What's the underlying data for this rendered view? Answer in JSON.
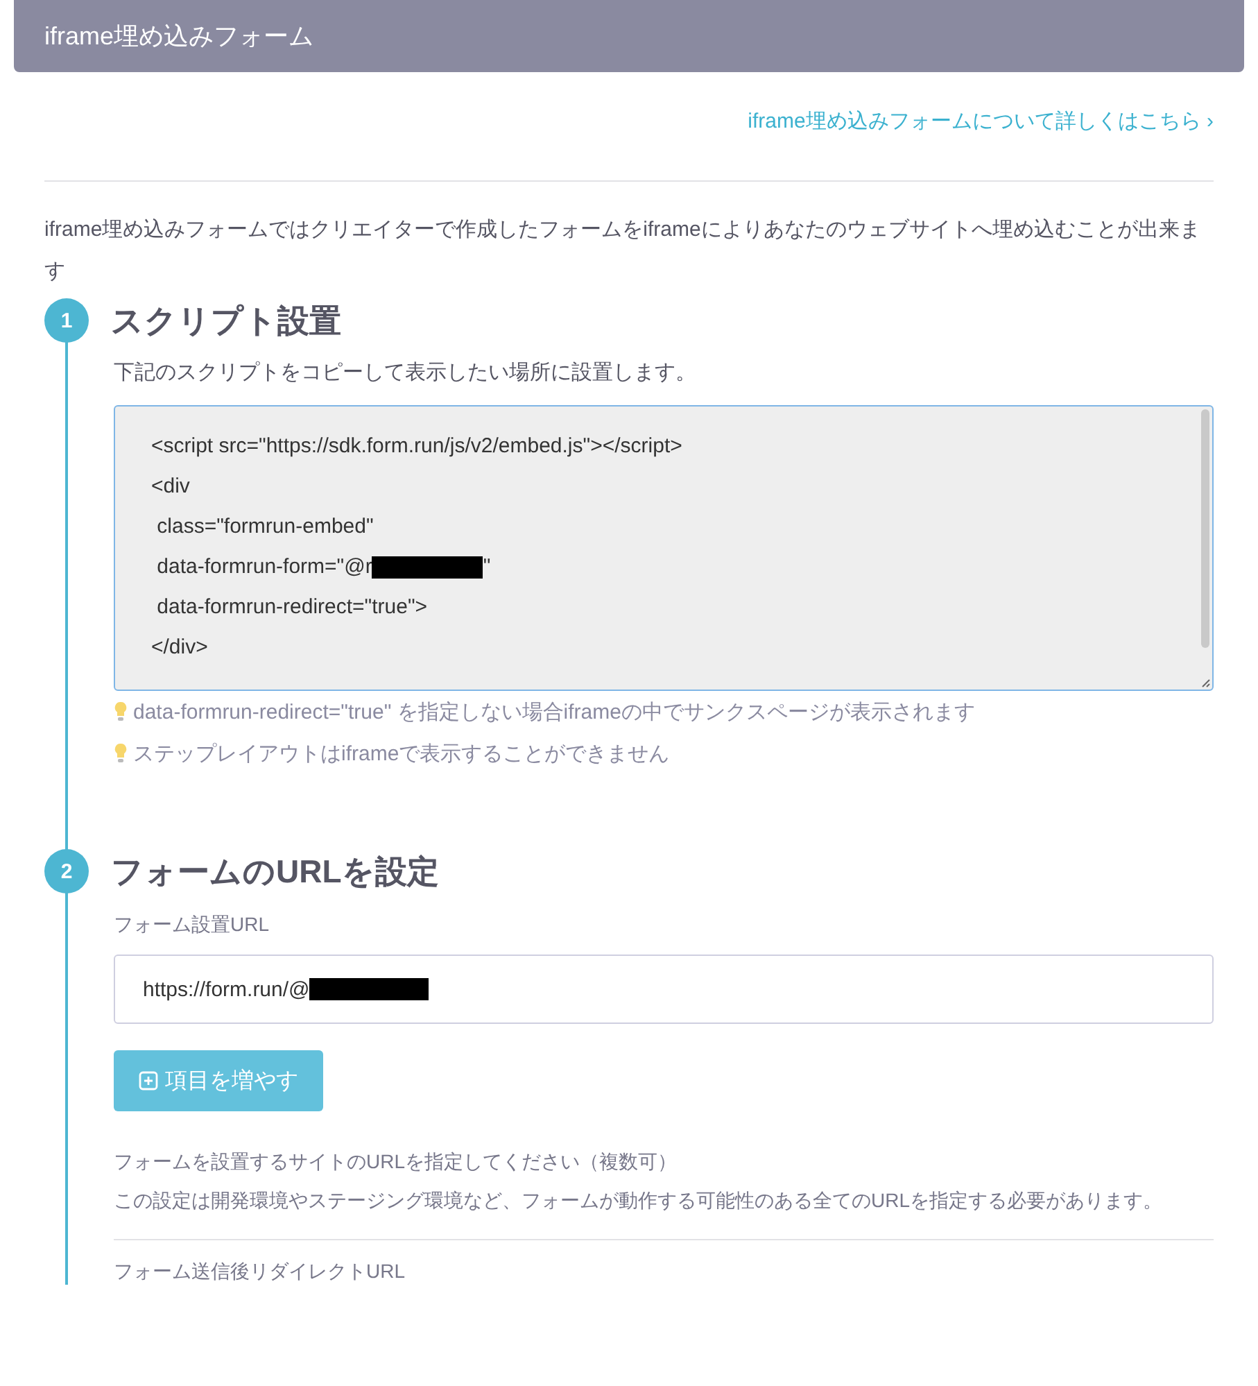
{
  "header": {
    "title": "iframe埋め込みフォーム"
  },
  "help_link": {
    "label": "iframe埋め込みフォームについて詳しくはこちら",
    "chevron": "›"
  },
  "intro": "iframe埋め込みフォームではクリエイターで作成したフォームをiframeによりあなたのウェブサイトへ埋め込むことが出来ます",
  "steps": [
    {
      "number": "1",
      "title": "スクリプト設置",
      "description": "下記のスクリプトをコピーして表示したい場所に設置します。",
      "code_lines": [
        {
          "text": "<script src=\"https://sdk.form.run/js/v2/embed.js\"></script>",
          "redacted": false
        },
        {
          "text": "<div",
          "redacted": false
        },
        {
          "text": " class=\"formrun-embed\"",
          "redacted": false
        },
        {
          "text": " data-formrun-form=\"@r",
          "redacted": true,
          "after": "\""
        },
        {
          "text": " data-formrun-redirect=\"true\">",
          "redacted": false
        },
        {
          "text": "</div>",
          "redacted": false
        }
      ],
      "tips": [
        "data-formrun-redirect=\"true\" を指定しない場合iframeの中でサンクスページが表示されます",
        "ステップレイアウトはiframeで表示することができません"
      ]
    },
    {
      "number": "2",
      "title": "フォームのURLを設定",
      "field_label": "フォーム設置URL",
      "url_value": "https://form.run/@",
      "url_redacted": true,
      "add_button": "項目を増やす",
      "notes": [
        "フォームを設置するサイトのURLを指定してください（複数可）",
        "この設定は開発環境やステージング環境など、フォームが動作する可能性のある全てのURLを指定する必要があります。"
      ],
      "redirect_label": "フォーム送信後リダイレクトURL"
    }
  ]
}
